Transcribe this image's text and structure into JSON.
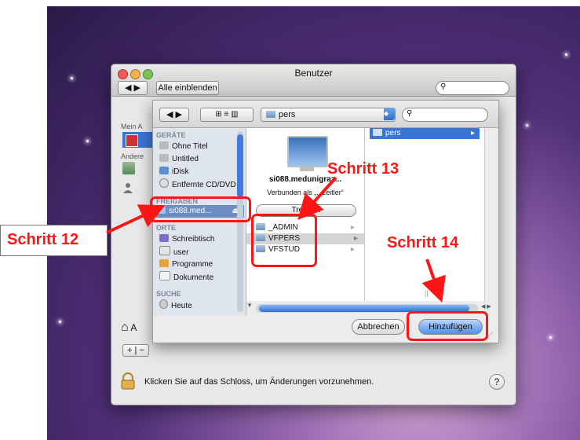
{
  "window": {
    "title": "Benutzer",
    "show_all_label": "Alle einblenden",
    "search_placeholder": ""
  },
  "left_panel": {
    "section_label": "Mein A",
    "other_label": "Andere",
    "bottom_item_label": "A"
  },
  "sheet": {
    "path_popup": "pers",
    "search_placeholder": "",
    "sidebar": {
      "devices_header": "GERÄTE",
      "devices": [
        "Ohne Titel",
        "Untitled",
        "iDisk",
        "Entfernte CD/DVD"
      ],
      "shared_header": "FREIGABEN",
      "shared": [
        "si088.med..."
      ],
      "places_header": "ORTE",
      "places": [
        "Schreibtisch",
        "user",
        "Programme",
        "Dokumente"
      ],
      "search_header": "SUCHE",
      "search": [
        "Heute"
      ]
    },
    "server": {
      "name": "si088.medunigraz...",
      "status": "Verbunden als „...zeitler“",
      "disconnect_label": "Trennen"
    },
    "folders": [
      "_ADMIN",
      "VFPERS",
      "VFSTUD"
    ],
    "column2": [
      "pers"
    ],
    "cancel_label": "Abbrechen",
    "add_label": "Hinzufügen"
  },
  "lock_text": "Klicken Sie auf das Schloss, um Änderungen vorzunehmen.",
  "help_label": "?",
  "annotations": {
    "step12": "Schritt 12",
    "step13": "Schritt 13",
    "step14": "Schritt 14"
  },
  "colors": {
    "annotation_red": "#ff1515",
    "selection_blue": "#3875d7",
    "shared_selected": "#6d8cc1"
  }
}
